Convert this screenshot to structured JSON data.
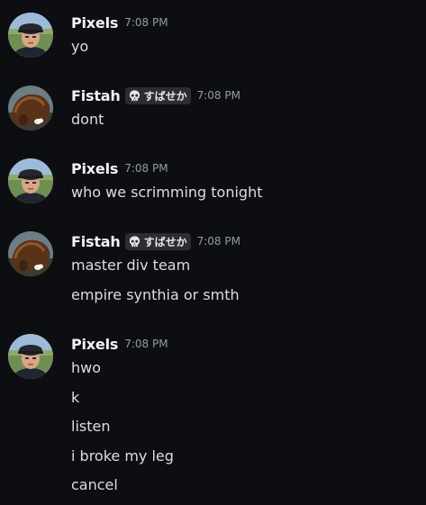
{
  "colors": {
    "background": "#0d0e12",
    "username": "#f2f3f5",
    "message_text": "#dbdee1",
    "timestamp": "#949ba4",
    "tag_background": "#2b2d31"
  },
  "groups": [
    {
      "author": "Pixels",
      "avatar_icon": "pixels-avatar",
      "time": "7:08 PM",
      "messages": [
        "yo"
      ]
    },
    {
      "author": "Fistah",
      "avatar_icon": "fistah-avatar",
      "tag_icon": "skull-icon",
      "tag": "すばせか",
      "time": "7:08 PM",
      "messages": [
        "dont"
      ]
    },
    {
      "author": "Pixels",
      "avatar_icon": "pixels-avatar",
      "time": "7:08 PM",
      "messages": [
        "who we scrimming tonight"
      ]
    },
    {
      "author": "Fistah",
      "avatar_icon": "fistah-avatar",
      "tag_icon": "skull-icon",
      "tag": "すばせか",
      "time": "7:08 PM",
      "messages": [
        "master div team",
        "empire synthia or smth"
      ]
    },
    {
      "author": "Pixels",
      "avatar_icon": "pixels-avatar",
      "time": "7:08 PM",
      "messages": [
        "hwo",
        "k",
        "listen",
        "i broke my leg",
        "cancel"
      ]
    }
  ]
}
